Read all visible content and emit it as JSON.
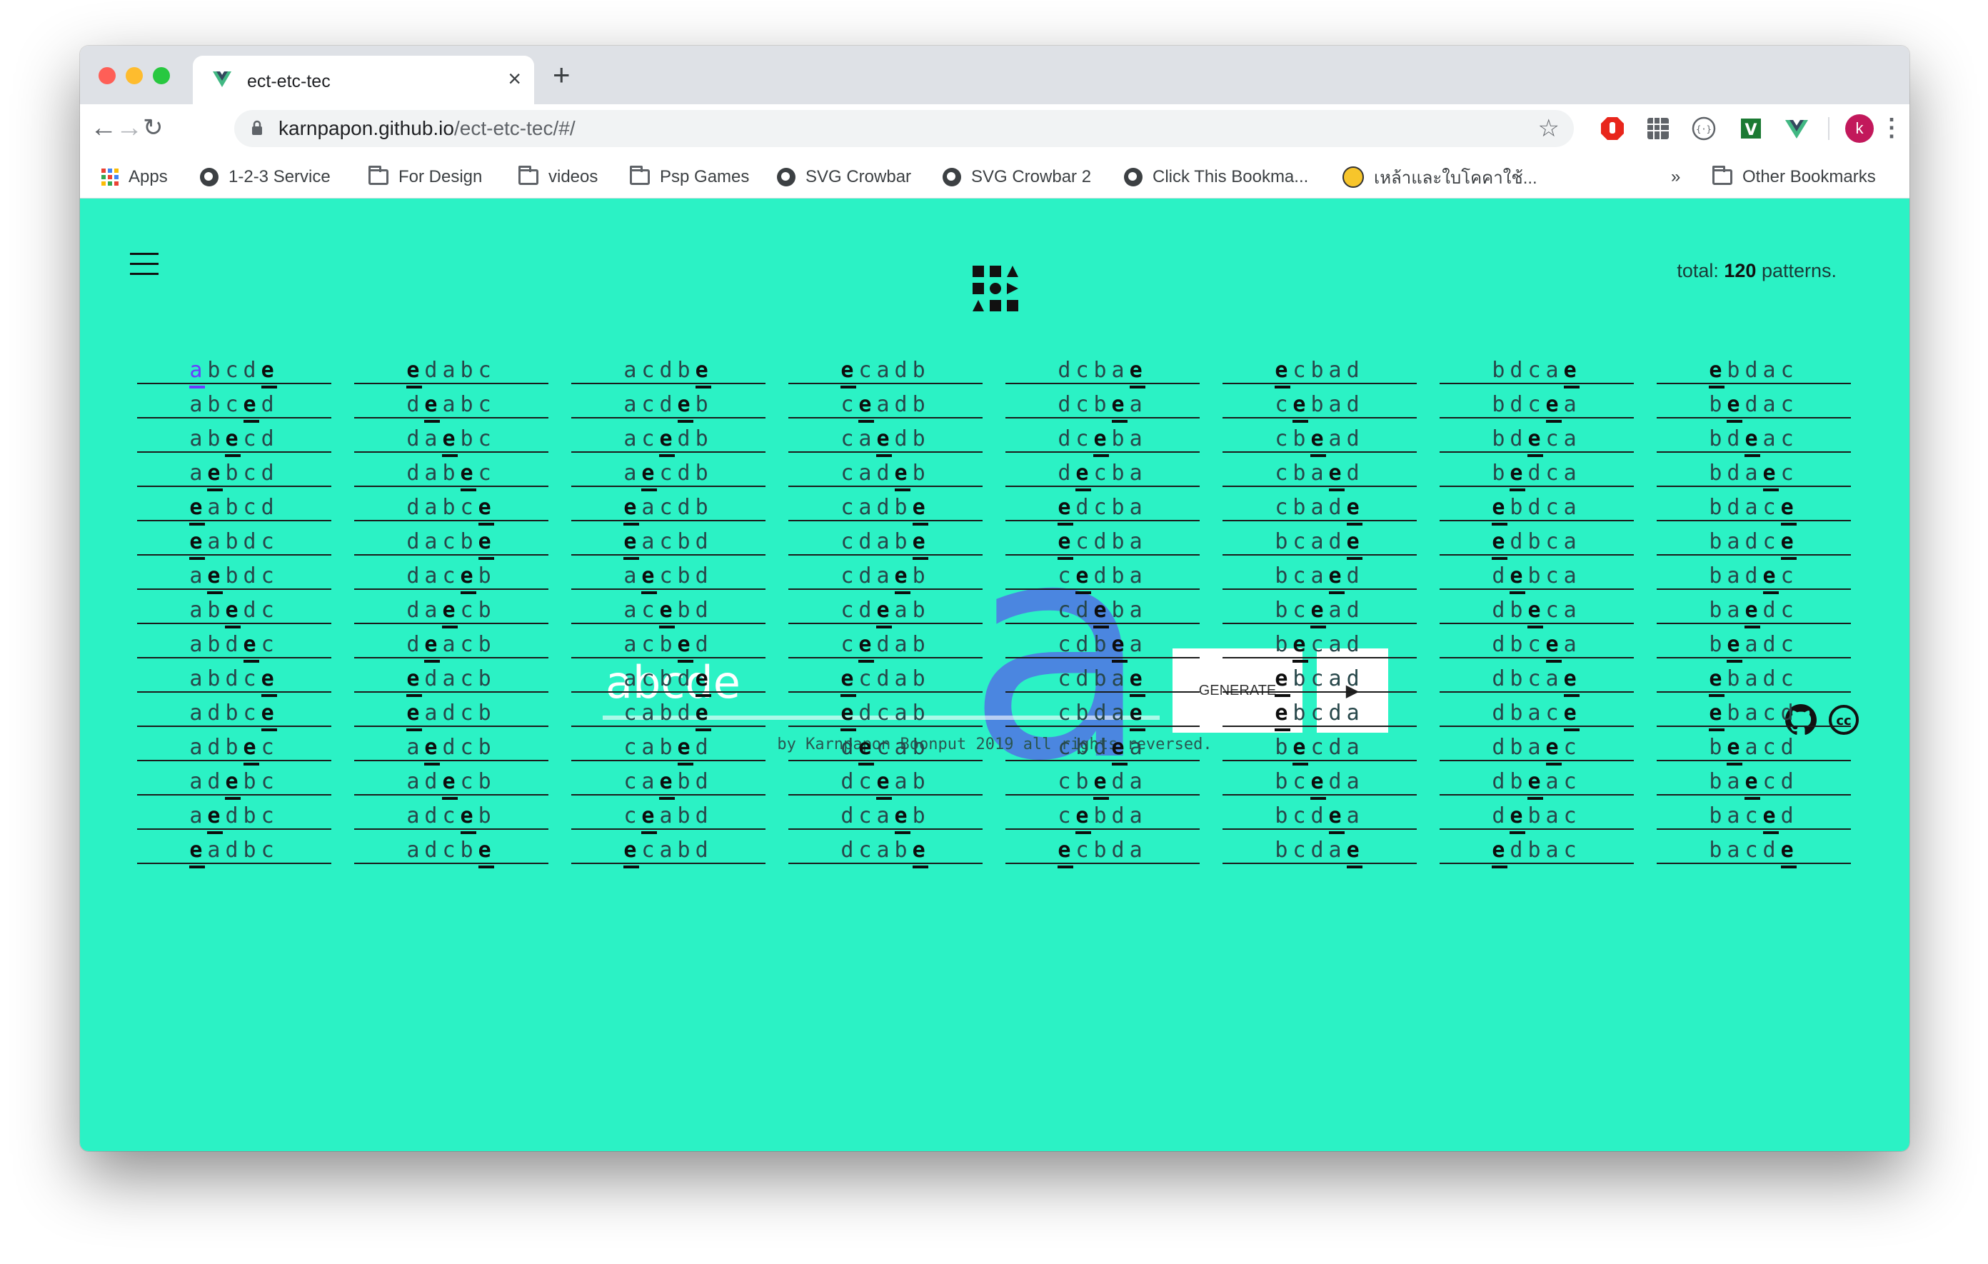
{
  "browser": {
    "tab_title": "ect-etc-tec",
    "new_tab_label": "+",
    "url_host": "karnpapon.github.io",
    "url_path": "/ect-etc-tec/#/",
    "profile_initial": "k",
    "bookmarks": [
      "Apps",
      "1-2-3 Service",
      "For Design",
      "videos",
      "Psp Games",
      "SVG Crowbar",
      "SVG Crowbar 2",
      "Click This Bookma...",
      "เหล้าและใบโคคาใช้..."
    ],
    "bookmarks_overflow": "»",
    "other_bookmarks": "Other Bookmarks"
  },
  "header": {
    "total_prefix": "total: ",
    "total_count": "120",
    "total_suffix": " patterns."
  },
  "highlight_letter": "e",
  "current_letter": "a",
  "columns": [
    [
      "abcde",
      "abced",
      "abecd",
      "aebcd",
      "eabcd",
      "eabdc",
      "aebdc",
      "abedc",
      "abdec",
      "abdce",
      "adbce",
      "adbec",
      "adebc",
      "aedbc",
      "eadbc"
    ],
    [
      "edabc",
      "deabc",
      "daebc",
      "dabec",
      "dabce",
      "dacbe",
      "daceb",
      "daecb",
      "deacb",
      "edacb",
      "eadcb",
      "aedcb",
      "adecb",
      "adceb",
      "adcbe"
    ],
    [
      "acdbe",
      "acdeb",
      "acedb",
      "aecdb",
      "eacdb",
      "eacbd",
      "aecbd",
      "acebd",
      "acbed",
      "acbde",
      "cabde",
      "cabed",
      "caebd",
      "ceabd",
      "ecabd"
    ],
    [
      "ecadb",
      "ceadb",
      "caedb",
      "cadeb",
      "cadbe",
      "cdabe",
      "cdaeb",
      "cdeab",
      "cedab",
      "ecdab",
      "edcab",
      "decab",
      "dceab",
      "dcaeb",
      "dcabe"
    ],
    [
      "dcbae",
      "dcbea",
      "dceba",
      "decba",
      "edcba",
      "ecdba",
      "cedba",
      "cdeba",
      "cdbea",
      "cdbae",
      "cbdae",
      "cbdea",
      "cbeda",
      "cebda",
      "ecbda"
    ],
    [
      "ecbad",
      "cebad",
      "cbead",
      "cbaed",
      "cbade",
      "bcade",
      "bcaed",
      "bcead",
      "becad",
      "ebcad",
      "ebcda",
      "becda",
      "bceda",
      "bcdea",
      "bcdae"
    ],
    [
      "bdcae",
      "bdcea",
      "bdeca",
      "bedca",
      "ebdca",
      "edbca",
      "debca",
      "dbeca",
      "dbcea",
      "dbcae",
      "dbace",
      "dbaec",
      "dbeac",
      "debac",
      "edbac"
    ],
    [
      "ebdac",
      "bedac",
      "bdeac",
      "bdaec",
      "bdace",
      "badce",
      "badec",
      "baedc",
      "beadc",
      "ebadc",
      "ebacd",
      "beacd",
      "baecd",
      "baced",
      "bacde"
    ]
  ],
  "overlay_letter": "a",
  "overlay_color": "#4b86e0",
  "background_color": "#2bf2c5",
  "form": {
    "input_value": "abcde",
    "generate_label": "GENERATE",
    "play_label": "▶"
  },
  "footer": {
    "credit": "by Karnpapon Boonput 2019 all rights reversed."
  },
  "icons": [
    "menu-icon",
    "logo-icon",
    "github-icon",
    "cc-icon"
  ]
}
